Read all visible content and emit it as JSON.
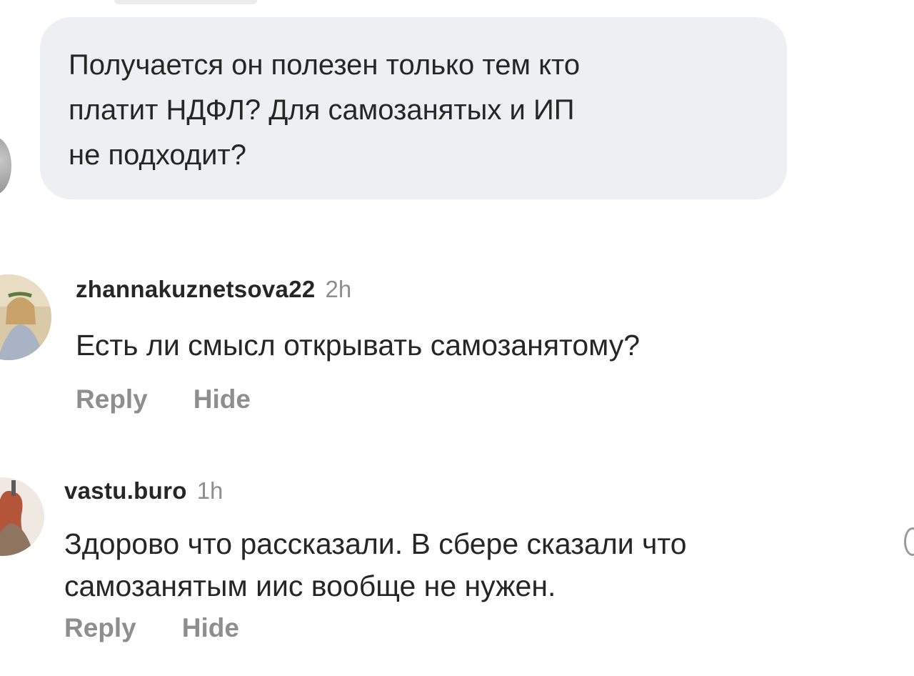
{
  "parent_comment": {
    "text": "Получается он полезен только тем кто\nплатит НДФЛ? Для самозанятых и ИП\nне подходит?"
  },
  "comments": [
    {
      "username": "zhannakuznetsova22",
      "time": "2h",
      "text": "Есть ли смысл открывать самозанятому?",
      "reply_label": "Reply",
      "hide_label": "Hide"
    },
    {
      "username": "vastu.buro",
      "time": "1h",
      "text": "Здорово что рассказали. В сбере сказали  что\nсамозанятым иис вообще не нужен.",
      "reply_label": "Reply",
      "hide_label": "Hide"
    }
  ],
  "colors": {
    "bubble_bg": "#eeeff3",
    "text": "#262626",
    "secondary": "#8e8e8e"
  }
}
